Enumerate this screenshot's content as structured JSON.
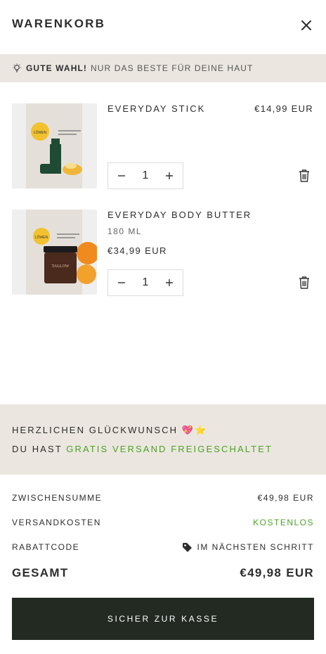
{
  "header": {
    "title": "WARENKORB"
  },
  "promo": {
    "bold": "GUTE WAHL!",
    "rest": "NUR DAS BESTE FÜR DEINE HAUT"
  },
  "items": [
    {
      "name": "EVERYDAY STICK",
      "price": "€14,99 EUR",
      "quantity": "1",
      "product_label": "TALLOW",
      "badge": "LÖWEN"
    },
    {
      "name": "EVERYDAY BODY BUTTER",
      "variant": "180 ML",
      "price": "€34,99 EUR",
      "quantity": "1",
      "product_label": "TALLOW",
      "badge": "LÖWEN"
    }
  ],
  "congrats": {
    "line1": "HERZLICHEN GLÜCKWUNSCH",
    "line2_prefix": "DU HAST",
    "line2_highlight": "GRATIS VERSAND FREIGESCHALTET",
    "emoji": "💖⭐"
  },
  "summary": {
    "subtotal_label": "ZWISCHENSUMME",
    "subtotal_value": "€49,98 EUR",
    "shipping_label": "VERSANDKOSTEN",
    "shipping_value": "KOSTENLOS",
    "discount_label": "RABATTCODE",
    "discount_value": "IM NÄCHSTEN SCHRITT",
    "total_label": "GESAMT",
    "total_value": "€49,98 EUR"
  },
  "checkout_label": "SICHER ZUR KASSE",
  "colors": {
    "promo_bg": "#ebe7e0",
    "accent_green": "#4ea128",
    "checkout_bg": "#232a22"
  }
}
